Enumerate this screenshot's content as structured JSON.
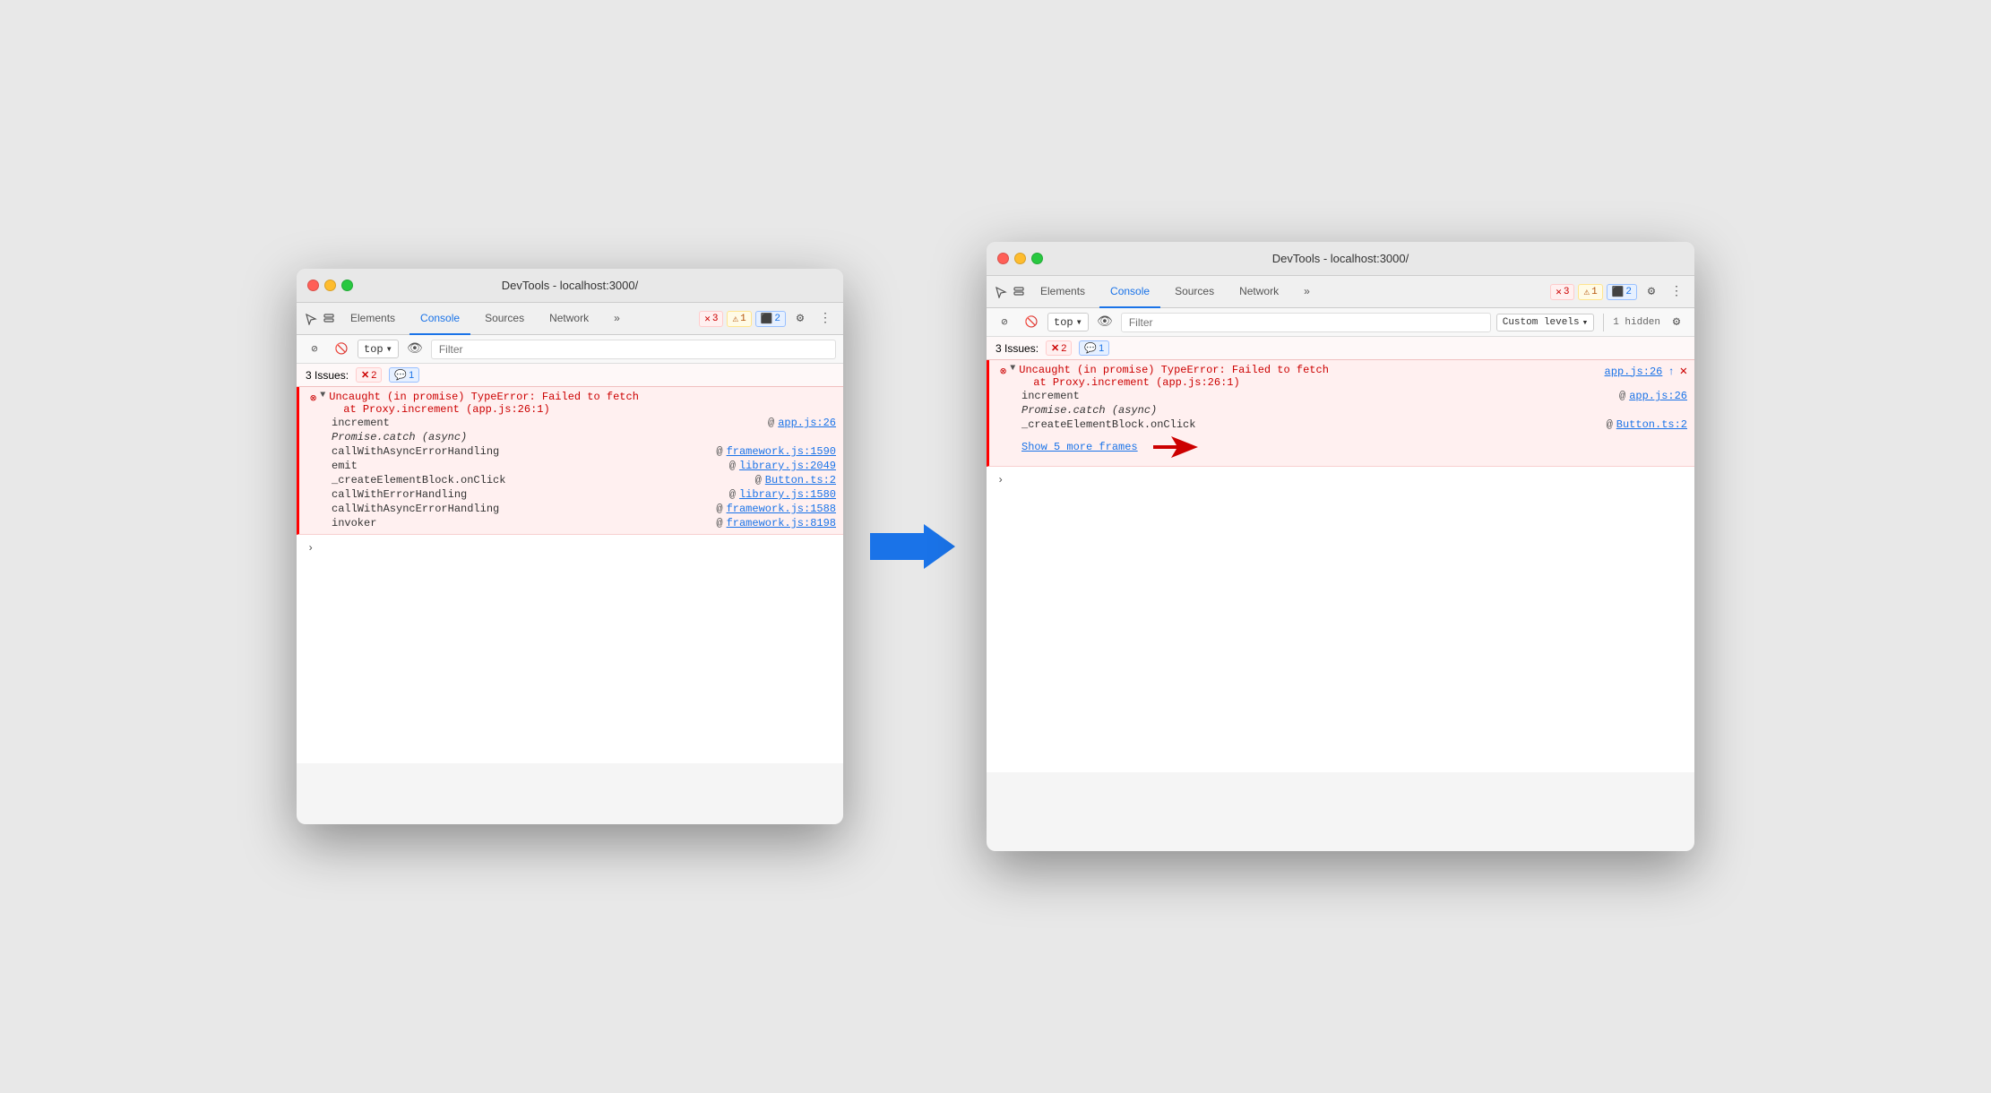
{
  "window1": {
    "title": "DevTools - localhost:3000/",
    "tabs": [
      "Elements",
      "Console",
      "Sources",
      "Network",
      "More"
    ],
    "active_tab": "Console",
    "toolbar": {
      "errors": "3",
      "warnings": "1",
      "info": "2"
    },
    "console": {
      "top_label": "top",
      "filter_placeholder": "Filter",
      "issues_label": "3 Issues:",
      "issues_errors": "2",
      "issues_info": "1"
    },
    "error": {
      "message_line1": "Uncaught (in promise) TypeError: Failed to fetch",
      "message_line2": "at Proxy.increment (app.js:26:1)",
      "stack": [
        {
          "func": "increment",
          "link": "app.js:26"
        },
        {
          "func": "Promise.catch (async)",
          "link": null
        },
        {
          "func": "callWithAsyncErrorHandling",
          "link": "framework.js:1590"
        },
        {
          "func": "emit",
          "link": "library.js:2049"
        },
        {
          "func": "_createElementBlock.onClick",
          "link": "Button.ts:2"
        },
        {
          "func": "callWithErrorHandling",
          "link": "library.js:1580"
        },
        {
          "func": "callWithAsyncErrorHandling",
          "link": "framework.js:1588"
        },
        {
          "func": "invoker",
          "link": "framework.js:8198"
        }
      ]
    }
  },
  "window2": {
    "title": "DevTools - localhost:3000/",
    "tabs": [
      "Elements",
      "Console",
      "Sources",
      "Network",
      "More"
    ],
    "active_tab": "Console",
    "toolbar": {
      "errors": "3",
      "warnings": "1",
      "info": "2"
    },
    "console": {
      "top_label": "top",
      "filter_placeholder": "Filter",
      "custom_levels": "Custom levels",
      "hidden_count": "1 hidden",
      "issues_label": "3 Issues:",
      "issues_errors": "2",
      "issues_info": "1"
    },
    "error": {
      "message_line1": "Uncaught (in promise) TypeError: Failed to fetch",
      "message_line2": "at Proxy.increment (app.js:26:1)",
      "file_link": "app.js:26",
      "stack": [
        {
          "func": "increment",
          "link": "app.js:26"
        },
        {
          "func": "Promise.catch (async)",
          "link": null
        },
        {
          "func": "_createElementBlock.onClick",
          "link": "Button.ts:2"
        }
      ],
      "show_more": "Show 5 more frames"
    }
  },
  "arrow": {
    "blue": "➡",
    "red_label": "red-arrow"
  }
}
